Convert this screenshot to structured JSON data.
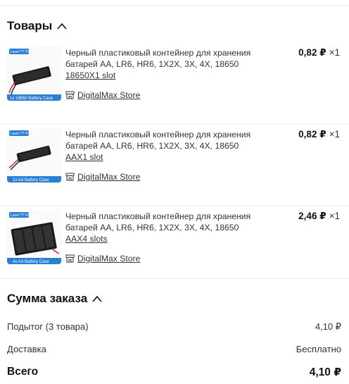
{
  "products_section": {
    "title": "Товары"
  },
  "items": [
    {
      "title": "Черный пластиковый контейнер для хранения батарей AA, LR6, HR6, 1X2X, 3X, 4X, 18650",
      "variant": "18650X1 slot",
      "store": "DigitalMax Store",
      "price": "0,82 ₽",
      "qty": "×1",
      "thumb_badge": "Lavel ??' Plastic",
      "thumb_caption": "1x 18650 Battery Case",
      "slots": 1,
      "icon": "battery-holder-image"
    },
    {
      "title": "Черный пластиковый контейнер для хранения батарей AA, LR6, HR6, 1X2X, 3X, 4X, 18650",
      "variant": "AAX1 slot",
      "store": "DigitalMax Store",
      "price": "0,82 ₽",
      "qty": "×1",
      "thumb_badge": "Lavel ??' Plastic",
      "thumb_caption": "1x AA Battery Case",
      "slots": 1,
      "icon": "battery-holder-image"
    },
    {
      "title": "Черный пластиковый контейнер для хранения батарей AA, LR6, HR6, 1X2X, 3X, 4X, 18650",
      "variant": "AAX4 slots",
      "store": "DigitalMax Store",
      "price": "2,46 ₽",
      "qty": "×1",
      "thumb_badge": "Lavel ??' Plastic",
      "thumb_caption": "4x AA Battery Case",
      "slots": 4,
      "icon": "battery-holder-image"
    }
  ],
  "summary": {
    "title": "Сумма заказа",
    "subtotal_label": "Подытог (3 товара)",
    "subtotal_value": "4,10 ₽",
    "shipping_label": "Доставка",
    "shipping_value": "Бесплатно",
    "total_label": "Всего",
    "total_value": "4,10 ₽"
  },
  "colors": {
    "thumb_badge": "#2a7fd4",
    "thumb_caption": "#2a7fd4",
    "divider": "#ececec"
  },
  "icons": {
    "collapse": "chevron-up-icon",
    "store": "store-icon"
  }
}
